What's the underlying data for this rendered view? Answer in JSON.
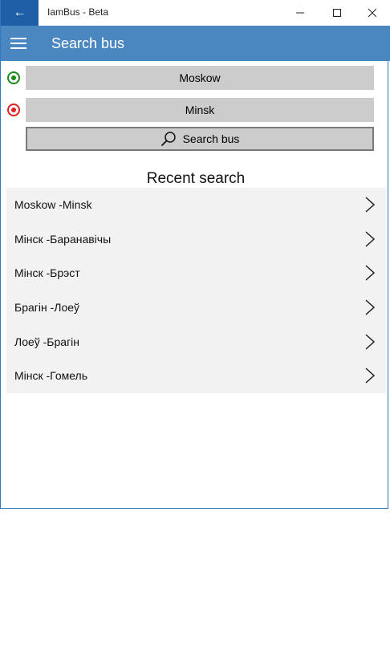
{
  "window": {
    "title": "IamBus - Beta",
    "back_icon": "←",
    "minimize_icon": "—",
    "maximize_icon": "☐",
    "close_icon": "✕"
  },
  "appbar": {
    "title": "Search bus"
  },
  "route": {
    "from": "Moskow",
    "to": "Minsk",
    "from_color": "#1a8a1a",
    "to_color": "#e02020"
  },
  "search_button": {
    "label": "Search bus"
  },
  "recent": {
    "title": "Recent search",
    "items": [
      "Moskow -Minsk",
      "Мінск -Баранавічы",
      "Мінск -Брэст",
      "Брагін -Лоеў",
      "Лоеў -Брагін",
      "Мінск -Гомель"
    ]
  }
}
